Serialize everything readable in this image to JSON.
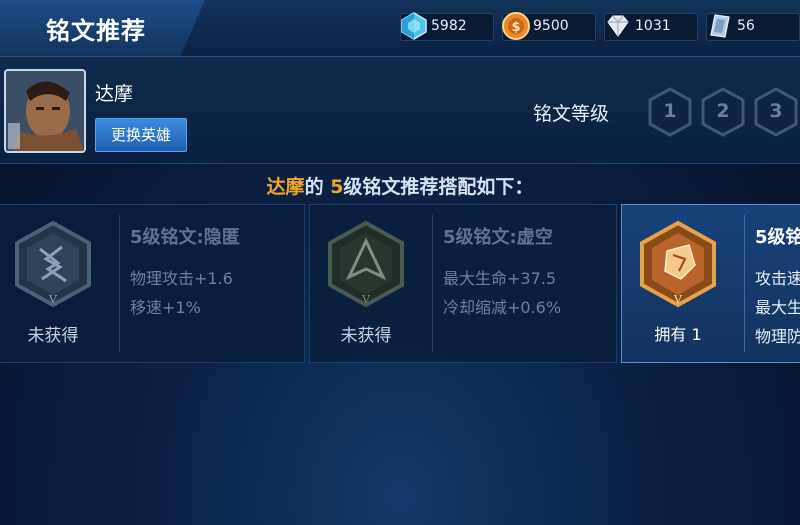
{
  "header": {
    "title": "铭文推荐"
  },
  "currencies": [
    {
      "icon": "diamond-icon",
      "value": "5982",
      "color": "#7fd4f5"
    },
    {
      "icon": "gold-coin-icon",
      "value": "9500",
      "color": "#f0a040"
    },
    {
      "icon": "crystal-icon",
      "value": "1031",
      "color": "#d8dde6"
    },
    {
      "icon": "fragment-icon",
      "value": "56",
      "color": "#a9c4e4"
    }
  ],
  "hero": {
    "name": "达摩",
    "change_button": "更换英雄"
  },
  "inscription_level": {
    "label": "铭文等级",
    "levels": [
      "1",
      "2",
      "3"
    ]
  },
  "recommend": {
    "hero": "达摩",
    "mid": "的 ",
    "level": "5",
    "suffix": "级铭文推荐搭配如下："
  },
  "cards": [
    {
      "name": "5级铭文:隐匿",
      "stats": [
        "物理攻击+1.6",
        "移速+1%"
      ],
      "status": "未获得",
      "owned": false,
      "numeral": "V"
    },
    {
      "name": "5级铭文:虚空",
      "stats": [
        "最大生命+37.5",
        "冷却缩减+0.6%"
      ],
      "status": "未获得",
      "owned": false,
      "numeral": "V"
    },
    {
      "name": "5级铭",
      "stats": [
        "攻击速",
        "最大生",
        "物理防"
      ],
      "status": "拥有 1",
      "owned": true,
      "numeral": "V"
    }
  ]
}
